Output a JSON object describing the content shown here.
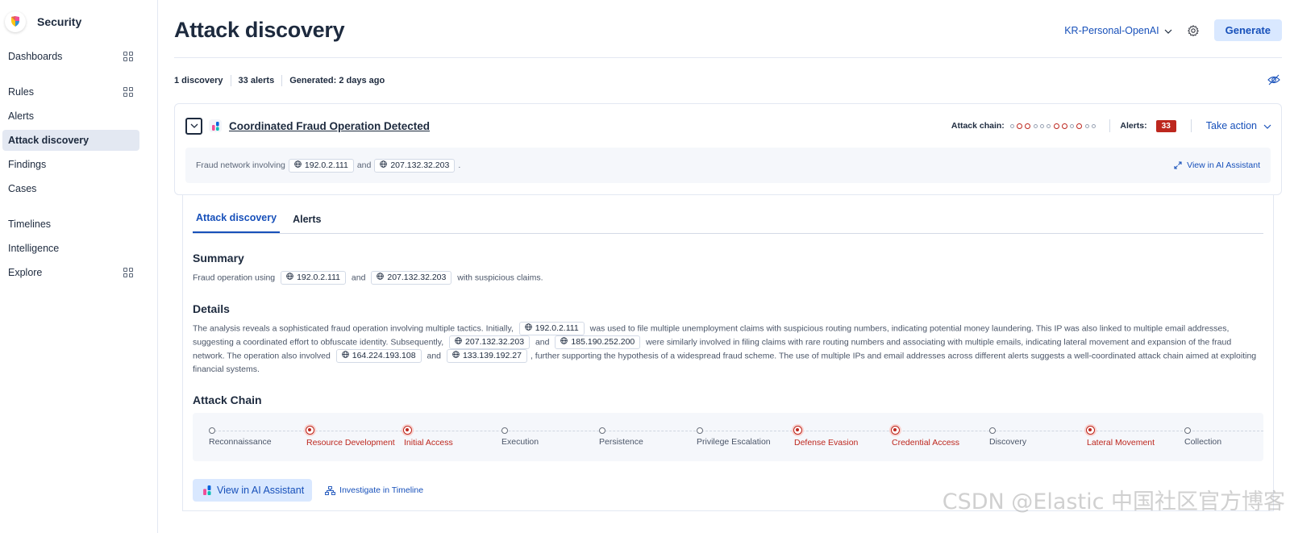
{
  "sidebar": {
    "app_title": "Security",
    "items": [
      {
        "label": "Dashboards"
      },
      {
        "label": "Rules"
      },
      {
        "label": "Alerts"
      },
      {
        "label": "Attack discovery"
      },
      {
        "label": "Findings"
      },
      {
        "label": "Cases"
      },
      {
        "label": "Timelines"
      },
      {
        "label": "Intelligence"
      },
      {
        "label": "Explore"
      }
    ]
  },
  "header": {
    "title": "Attack discovery",
    "connector": "KR-Personal-OpenAI",
    "generate_label": "Generate"
  },
  "stats": {
    "discoveries": "1 discovery",
    "alerts": "33 alerts",
    "generated": "Generated: 2 days ago"
  },
  "discovery": {
    "title": "Coordinated Fraud Operation Detected",
    "attack_chain_label": "Attack chain:",
    "alerts_label": "Alerts:",
    "alerts_count": "33",
    "take_action": "Take action",
    "summary_prefix": "Fraud network involving",
    "summary_ip1": "192.0.2.111",
    "summary_and": "and",
    "summary_ip2": "207.132.32.203",
    "summary_end": ".",
    "view_ai_link": "View in AI Assistant",
    "mini_chain_hits": [
      false,
      true,
      true,
      false,
      false,
      false,
      true,
      true,
      false,
      true,
      false,
      false
    ]
  },
  "expanded": {
    "tabs": [
      "Attack discovery",
      "Alerts"
    ],
    "summary_title": "Summary",
    "summary": {
      "t1": "Fraud operation using",
      "ip1": "192.0.2.111",
      "t2": "and",
      "ip2": "207.132.32.203",
      "t3": "with suspicious claims."
    },
    "details_title": "Details",
    "details": {
      "t1": "The analysis reveals a sophisticated fraud operation involving multiple tactics. Initially,",
      "ip1": "192.0.2.111",
      "t2": "was used to file multiple unemployment claims with suspicious routing numbers, indicating potential money laundering. This IP was also linked to multiple email addresses, suggesting a coordinated effort to obfuscate identity. Subsequently,",
      "ip2": "207.132.32.203",
      "t3": "and",
      "ip3": "185.190.252.200",
      "t4": "were similarly involved in filing claims with rare routing numbers and associating with multiple emails, indicating lateral movement and expansion of the fraud network. The operation also involved",
      "ip4": "164.224.193.108",
      "t5": "and",
      "ip5": "133.139.192.27",
      "t6": ", further supporting the hypothesis of a widespread fraud scheme. The use of multiple IPs and email addresses across different alerts suggests a well-coordinated attack chain aimed at exploiting financial systems."
    },
    "chain_title": "Attack Chain",
    "stages": [
      {
        "label": "Reconnaissance",
        "hit": false
      },
      {
        "label": "Resource Development",
        "hit": true
      },
      {
        "label": "Initial Access",
        "hit": true
      },
      {
        "label": "Execution",
        "hit": false
      },
      {
        "label": "Persistence",
        "hit": false
      },
      {
        "label": "Privilege Escalation",
        "hit": false
      },
      {
        "label": "Defense Evasion",
        "hit": true
      },
      {
        "label": "Credential Access",
        "hit": true
      },
      {
        "label": "Discovery",
        "hit": false
      },
      {
        "label": "Lateral Movement",
        "hit": true
      },
      {
        "label": "Collection",
        "hit": false
      }
    ],
    "ai_button": "View in AI Assistant",
    "timeline_link": "Investigate in Timeline"
  },
  "watermark": "CSDN @Elastic 中国社区官方博客",
  "colors": {
    "accent": "#1750ba",
    "danger": "#bd271e",
    "button_bg": "#d9e8ff"
  }
}
